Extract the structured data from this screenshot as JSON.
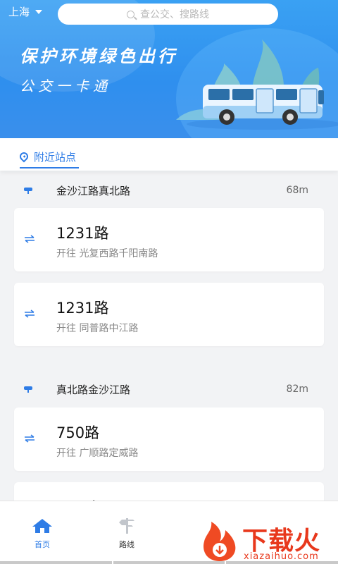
{
  "header": {
    "city": "上海",
    "search_placeholder": "查公交、搜路线",
    "slogan_line1": "保护环境绿色出行",
    "slogan_line2": "公交一卡通"
  },
  "tabs": {
    "nearby_label": "附近站点"
  },
  "stations": [
    {
      "name": "金沙江路真北路",
      "distance": "68m",
      "routes": [
        {
          "name": "1231路",
          "direction": "开往 光复西路千阳南路"
        },
        {
          "name": "1231路",
          "direction": "开往 同普路中江路"
        }
      ]
    },
    {
      "name": "真北路金沙江路",
      "distance": "82m",
      "routes": [
        {
          "name": "750路",
          "direction": "开往 广顺路定威路"
        },
        {
          "name": "750路",
          "direction": ""
        }
      ]
    }
  ],
  "bottom_nav": {
    "home_label": "首页",
    "routes_label": "路线"
  },
  "watermark": {
    "text": "下载火",
    "sub": "xiazaihuo.com"
  },
  "colors": {
    "accent": "#2e7ce6",
    "banner": "#3a9af2",
    "watermark": "#e8381c"
  }
}
